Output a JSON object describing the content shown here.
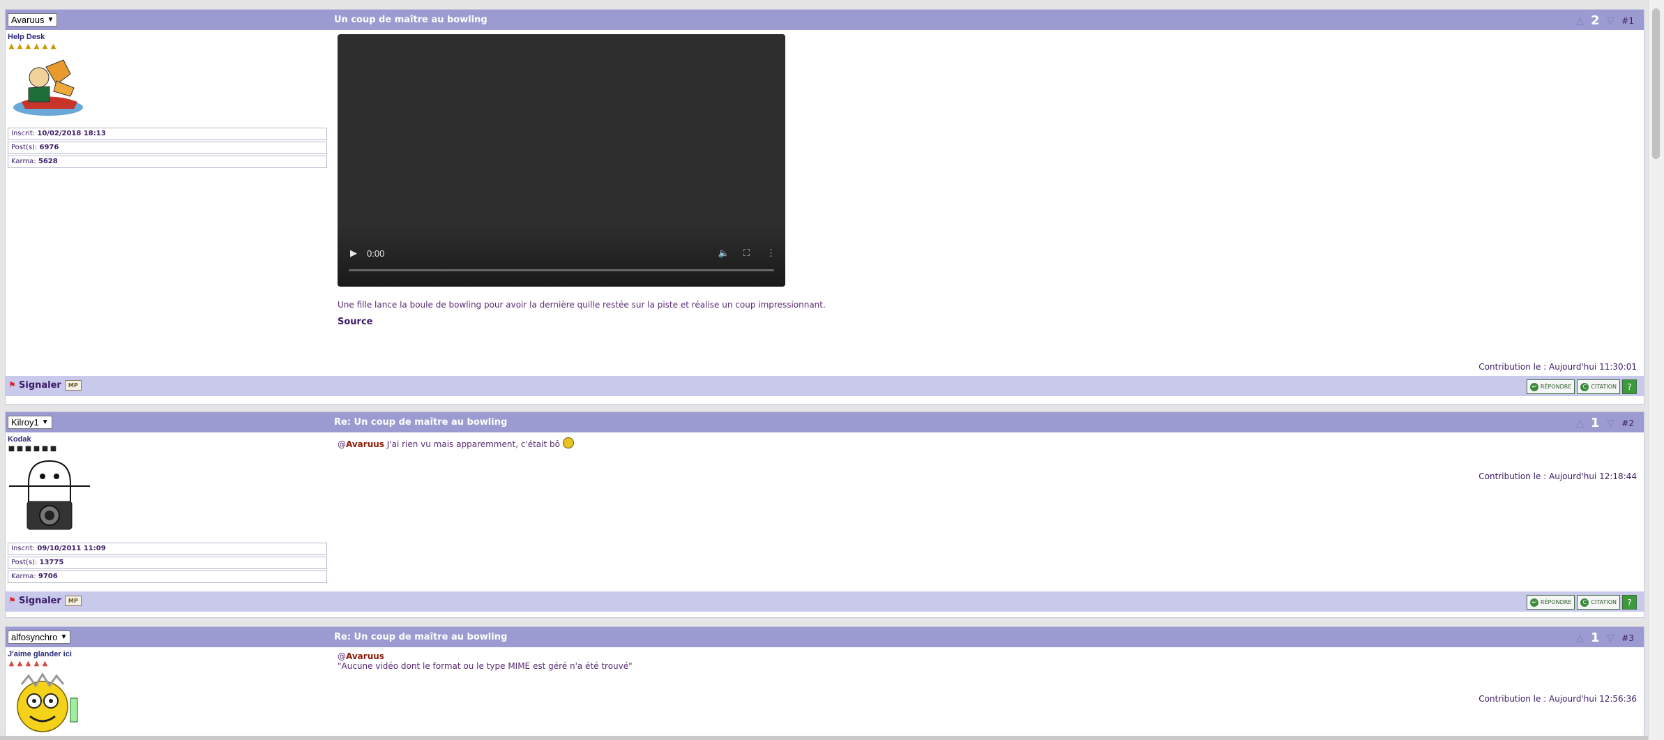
{
  "posts": [
    {
      "author": "Avaruus",
      "title": "Un coup de maître au bowling",
      "votes": "2",
      "post_number": "#1",
      "rank": "Help Desk",
      "star_count": 6,
      "registered_label": "Inscrit:",
      "registered": "10/02/2018 18:13",
      "posts_label": "Post(s):",
      "posts_count": "6976",
      "karma_label": "Karma:",
      "karma": "5628",
      "video_time": "0:00",
      "caption": "Une fille lance la boule de bowling pour avoir la dernière quille restée sur la piste et réalise un coup impressionnant.",
      "source": "Source",
      "date": "Contribution le : Aujourd'hui 11:30:01",
      "report": "Signaler"
    },
    {
      "author": "Kilroy1",
      "title": "Re: Un coup de maître au bowling",
      "votes": "1",
      "post_number": "#2",
      "rank": "Kodak",
      "star_count": 6,
      "registered_label": "Inscrit:",
      "registered": "09/10/2011 11:09",
      "posts_label": "Post(s):",
      "posts_count": "13775",
      "karma_label": "Karma:",
      "karma": "9706",
      "mention": "Avaruus",
      "mention_prefix": "@",
      "text": " J'ai rien vu mais apparemment, c'était bô ",
      "date": "Contribution le : Aujourd'hui 12:18:44",
      "report": "Signaler"
    },
    {
      "author": "alfosynchro",
      "title": "Re: Un coup de maître au bowling",
      "votes": "1",
      "post_number": "#3",
      "rank": "J'aime glander ici",
      "star_count": 5,
      "mention_prefix": "@",
      "mention": "Avaruus",
      "quote": "\"Aucune vidéo dont le format ou le type MIME est géré n'a été trouvé\"",
      "date": "Contribution le : Aujourd'hui 12:56:36"
    }
  ],
  "buttons": {
    "reply": "RÉPONDRE",
    "quote": "CITATION",
    "help": "?"
  },
  "colors": {
    "header": "#9b9bd1",
    "footer": "#c9c9ec",
    "text": "#3b1a66",
    "mention": "#8a1d0a"
  }
}
